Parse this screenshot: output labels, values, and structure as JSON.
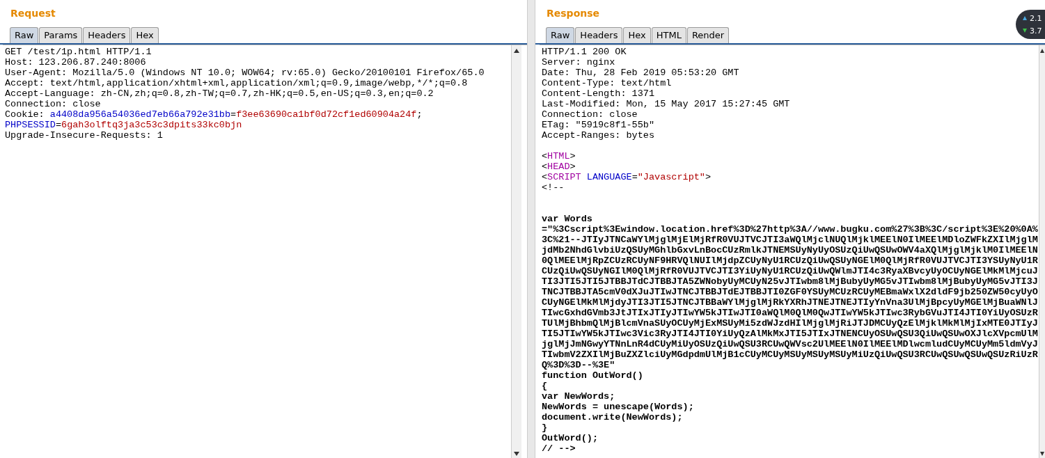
{
  "request": {
    "title": "Request",
    "tabs": [
      {
        "label": "Raw",
        "selected": true
      },
      {
        "label": "Params",
        "selected": false
      },
      {
        "label": "Headers",
        "selected": false
      },
      {
        "label": "Hex",
        "selected": false
      }
    ],
    "lines": [
      {
        "kind": "text",
        "segments": [
          {
            "kind": "plain",
            "text": "GET /test/1p.html HTTP/1.1"
          }
        ]
      },
      {
        "kind": "text",
        "segments": [
          {
            "kind": "plain",
            "text": "Host: 123.206.87.240:8006"
          }
        ]
      },
      {
        "kind": "text",
        "segments": [
          {
            "kind": "plain",
            "text": "User-Agent: Mozilla/5.0 (Windows NT 10.0; WOW64; rv:65.0) Gecko/20100101 Firefox/65.0"
          }
        ]
      },
      {
        "kind": "text",
        "segments": [
          {
            "kind": "plain",
            "text": "Accept: text/html,application/xhtml+xml,application/xml;q=0.9,image/webp,*/*;q=0.8"
          }
        ]
      },
      {
        "kind": "text",
        "segments": [
          {
            "kind": "plain",
            "text": "Accept-Language: zh-CN,zh;q=0.8,zh-TW;q=0.7,zh-HK;q=0.5,en-US;q=0.3,en;q=0.2"
          }
        ]
      },
      {
        "kind": "text",
        "segments": [
          {
            "kind": "plain",
            "text": "Connection: close"
          }
        ]
      },
      {
        "kind": "text",
        "segments": [
          {
            "kind": "plain",
            "text": "Cookie: "
          },
          {
            "kind": "name",
            "text": "a4408da956a54036ed7eb66a792e31bb"
          },
          {
            "kind": "plain",
            "text": "="
          },
          {
            "kind": "value",
            "text": "f3ee63690ca1bf0d72cf1ed60904a24f"
          },
          {
            "kind": "plain",
            "text": ";"
          }
        ]
      },
      {
        "kind": "text",
        "segments": [
          {
            "kind": "name",
            "text": "PHPSESSID"
          },
          {
            "kind": "plain",
            "text": "="
          },
          {
            "kind": "value",
            "text": "6gah3olftq3ja3c53c3dpits33kc0bjn"
          }
        ]
      },
      {
        "kind": "text",
        "segments": [
          {
            "kind": "plain",
            "text": "Upgrade-Insecure-Requests: 1"
          }
        ]
      }
    ]
  },
  "response": {
    "title": "Response",
    "tabs": [
      {
        "label": "Raw",
        "selected": true
      },
      {
        "label": "Headers",
        "selected": false
      },
      {
        "label": "Hex",
        "selected": false
      },
      {
        "label": "HTML",
        "selected": false
      },
      {
        "label": "Render",
        "selected": false
      }
    ],
    "lines": [
      {
        "kind": "text",
        "segments": [
          {
            "kind": "plain",
            "text": "HTTP/1.1 200 OK"
          }
        ]
      },
      {
        "kind": "text",
        "segments": [
          {
            "kind": "plain",
            "text": "Server: nginx"
          }
        ]
      },
      {
        "kind": "text",
        "segments": [
          {
            "kind": "plain",
            "text": "Date: Thu, 28 Feb 2019 05:53:20 GMT"
          }
        ]
      },
      {
        "kind": "text",
        "segments": [
          {
            "kind": "plain",
            "text": "Content-Type: text/html"
          }
        ]
      },
      {
        "kind": "text",
        "segments": [
          {
            "kind": "plain",
            "text": "Content-Length: 1371"
          }
        ]
      },
      {
        "kind": "text",
        "segments": [
          {
            "kind": "plain",
            "text": "Last-Modified: Mon, 15 May 2017 15:27:45 GMT"
          }
        ]
      },
      {
        "kind": "text",
        "segments": [
          {
            "kind": "plain",
            "text": "Connection: close"
          }
        ]
      },
      {
        "kind": "text",
        "segments": [
          {
            "kind": "plain",
            "text": "ETag: \"5919c8f1-55b\""
          }
        ]
      },
      {
        "kind": "text",
        "segments": [
          {
            "kind": "plain",
            "text": "Accept-Ranges: bytes"
          }
        ]
      },
      {
        "kind": "blank"
      },
      {
        "kind": "text",
        "segments": [
          {
            "kind": "plain",
            "text": "<"
          },
          {
            "kind": "tag",
            "text": "HTML"
          },
          {
            "kind": "plain",
            "text": ">"
          }
        ]
      },
      {
        "kind": "text",
        "segments": [
          {
            "kind": "plain",
            "text": "<"
          },
          {
            "kind": "tag",
            "text": "HEAD"
          },
          {
            "kind": "plain",
            "text": ">"
          }
        ]
      },
      {
        "kind": "text",
        "segments": [
          {
            "kind": "plain",
            "text": "<"
          },
          {
            "kind": "tag",
            "text": "SCRIPT"
          },
          {
            "kind": "name",
            "text": " LANGUAGE"
          },
          {
            "kind": "plain",
            "text": "="
          },
          {
            "kind": "value",
            "text": "\"Javascript\""
          },
          {
            "kind": "plain",
            "text": ">"
          }
        ]
      },
      {
        "kind": "text",
        "segments": [
          {
            "kind": "plain",
            "text": "<!--"
          }
        ]
      },
      {
        "kind": "blank"
      },
      {
        "kind": "blank"
      },
      {
        "kind": "text",
        "segments": [
          {
            "kind": "code",
            "text": "var Words"
          }
        ]
      },
      {
        "kind": "text",
        "segments": [
          {
            "kind": "code",
            "text": "=\"%3Cscript%3Ewindow.location.href%3D%27http%3A//www.bugku.com%27%3B%3C/script%3E%20%0A%"
          }
        ]
      },
      {
        "kind": "text",
        "segments": [
          {
            "kind": "code",
            "text": "3C%21--JTIyJTNCaWYlMjglMjElMjRfR0VUJTVCJTI3aWQlMjclNUQlMjklMEElN0IlMEElMDloZWFkZXIlMjglM"
          }
        ]
      },
      {
        "kind": "text",
        "segments": [
          {
            "kind": "code",
            "text": "jdMb2NhdGlvbiUzQSUyMGhlbGxvLnBocCUzRmlkJTNEMSUyNyUyOSUzQiUwQSUwOWV4aXQlMjglMjklM0IlMEElN"
          }
        ]
      },
      {
        "kind": "text",
        "segments": [
          {
            "kind": "code",
            "text": "0QlMEElMjRpZCUzRCUyNF9HRVQlNUIlMjdpZCUyNyU1RCUzQiUwQSUyNGElM0QlMjRfR0VUJTVCJTI3YSUyNyU1R"
          }
        ]
      },
      {
        "kind": "text",
        "segments": [
          {
            "kind": "code",
            "text": "CUzQiUwQSUyNGIlM0QlMjRfR0VUJTVCJTI3YiUyNyU1RCUzQiUwQWlmJTI4c3RyaXBvcyUyOCUyNGElMkMlMjcuJ"
          }
        ]
      },
      {
        "kind": "text",
        "segments": [
          {
            "kind": "code",
            "text": "TI3JTI5JTI5JTBBJTdCJTBBJTA5ZWNobyUyMCUyN25vJTIwbm8lMjBubyUyMG5vJTIwbm8lMjBubyUyMG5vJTI3J"
          }
        ]
      },
      {
        "kind": "text",
        "segments": [
          {
            "kind": "code",
            "text": "TNCJTBBJTA5cmV0dXJuJTIwJTNCJTBBJTdEJTBBJTI0ZGF0YSUyMCUzRCUyMEBmaWxlX2dldF9jb250ZW50cyUyO"
          }
        ]
      },
      {
        "kind": "text",
        "segments": [
          {
            "kind": "code",
            "text": "CUyNGElMkMlMjdyJTI3JTI5JTNCJTBBaWYlMjglMjRkYXRhJTNEJTNEJTIyYnVna3UlMjBpcyUyMGElMjBuaWNlJ"
          }
        ]
      },
      {
        "kind": "text",
        "segments": [
          {
            "kind": "code",
            "text": "TIwcGxhdGVmb3JtJTIxJTIyJTIwYW5kJTIwJTI0aWQlM0QlM0QwJTIwYW5kJTIwc3RybGVuJTI4JTI0YiUyOSUzR"
          }
        ]
      },
      {
        "kind": "text",
        "segments": [
          {
            "kind": "code",
            "text": "TUlMjBhbmQlMjBlcmVnaSUyOCUyMjExMSUyMi5zdWJzdHIlMjglMjRiJTJDMCUyQzElMjklMkMlMjIxMTE0JTIyJ"
          }
        ]
      },
      {
        "kind": "text",
        "segments": [
          {
            "kind": "code",
            "text": "TI5JTIwYW5kJTIwc3Vic3RyJTI4JTI0YiUyQzAlMkMxJTI5JTIxJTNENCUyOSUwQSU3QiUwQSUwOXJlcXVpcmUlM"
          }
        ]
      },
      {
        "kind": "text",
        "segments": [
          {
            "kind": "code",
            "text": "jglMjJmNGwyYTNnLnR4dCUyMiUyOSUzQiUwQSU3RCUwQWVsc2UlMEElN0IlMEElMDlwcmludCUyMCUyMm5ldmVyJ"
          }
        ]
      },
      {
        "kind": "text",
        "segments": [
          {
            "kind": "code",
            "text": "TIwbmV2ZXIlMjBuZXZlciUyMGdpdmUlMjB1cCUyMCUyMSUyMSUyMSUyMiUzQiUwQSU3RCUwQSUwQSUwQSUzRiUzR"
          }
        ]
      },
      {
        "kind": "text",
        "segments": [
          {
            "kind": "code",
            "text": "Q%3D%3D--%3E\""
          }
        ]
      },
      {
        "kind": "text",
        "segments": [
          {
            "kind": "code",
            "text": "function OutWord()"
          }
        ]
      },
      {
        "kind": "text",
        "segments": [
          {
            "kind": "code",
            "text": "{"
          }
        ]
      },
      {
        "kind": "text",
        "segments": [
          {
            "kind": "code",
            "text": "var NewWords;"
          }
        ]
      },
      {
        "kind": "text",
        "segments": [
          {
            "kind": "code",
            "text": "NewWords = unescape(Words);"
          }
        ]
      },
      {
        "kind": "text",
        "segments": [
          {
            "kind": "code",
            "text": "document.write(NewWords);"
          }
        ]
      },
      {
        "kind": "text",
        "segments": [
          {
            "kind": "code",
            "text": "}"
          }
        ]
      },
      {
        "kind": "text",
        "segments": [
          {
            "kind": "code",
            "text": "OutWord();"
          }
        ]
      },
      {
        "kind": "text",
        "segments": [
          {
            "kind": "code",
            "text": "// -->"
          }
        ]
      }
    ]
  },
  "speed_badge": {
    "upload": "2.1",
    "download": "3.7"
  }
}
